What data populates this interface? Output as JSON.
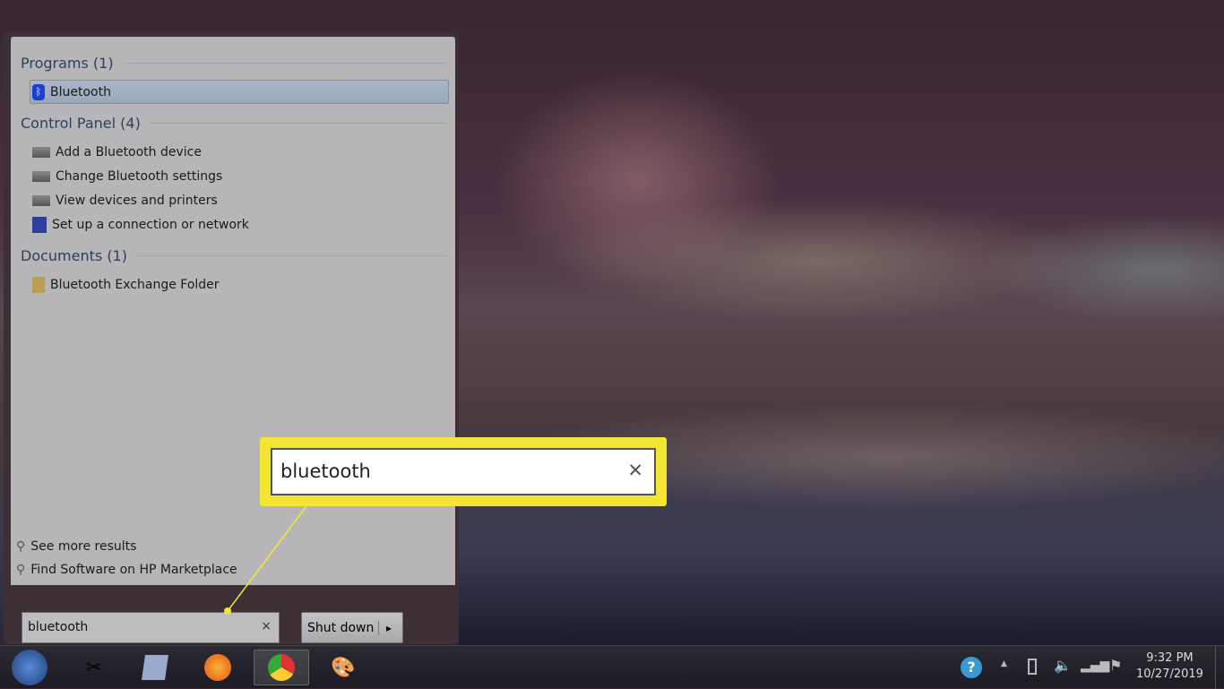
{
  "start_menu": {
    "sections": [
      {
        "title": "Programs (1)",
        "items": [
          {
            "label": "Bluetooth",
            "icon": "bluetooth-icon",
            "selected": true
          }
        ]
      },
      {
        "title": "Control Panel (4)",
        "items": [
          {
            "label": "Add a Bluetooth device",
            "icon": "devices-icon"
          },
          {
            "label": "Change Bluetooth settings",
            "icon": "devices-icon"
          },
          {
            "label": "View devices and printers",
            "icon": "devices-icon"
          },
          {
            "label": "Set up a connection or network",
            "icon": "network-icon"
          }
        ]
      },
      {
        "title": "Documents (1)",
        "items": [
          {
            "label": "Bluetooth Exchange Folder",
            "icon": "folder-icon"
          }
        ]
      }
    ],
    "see_more": "See more results",
    "find_software": "Find Software on HP Marketplace",
    "search_value": "bluetooth",
    "clear": "×",
    "shutdown": "Shut down",
    "shutdown_arrow": "▸"
  },
  "callout": {
    "text": "bluetooth",
    "clear": "✕",
    "color": "#f5e533"
  },
  "taskbar": {
    "start": "start-orb-icon",
    "apps": [
      "snipping-tool",
      "notes",
      "firefox",
      "chrome",
      "paint"
    ],
    "tray": {
      "time": "9:32 PM",
      "date": "10/27/2019",
      "arrow": "▲"
    }
  }
}
